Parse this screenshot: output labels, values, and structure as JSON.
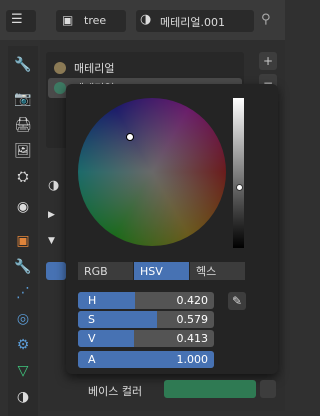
{
  "header": {
    "object_name": "tree",
    "material_name": "메테리얼.001"
  },
  "slots": [
    {
      "label": "매테리얼",
      "color": "#8b7a55"
    },
    {
      "label": "메테리얼.001",
      "color": "#3d7a63"
    }
  ],
  "side_buttons": {
    "add": "+",
    "remove": "−"
  },
  "colors": {
    "accent": "#4772b3",
    "base_color": "#2f7a53"
  },
  "picker": {
    "modes": [
      "RGB",
      "HSV",
      "헥스"
    ],
    "active_mode": "HSV",
    "hue": {
      "label": "H",
      "value": "0.420",
      "fill": 0.42
    },
    "sat": {
      "label": "S",
      "value": "0.579",
      "fill": 0.579
    },
    "val": {
      "label": "V",
      "value": "0.413",
      "fill": 0.413
    },
    "alpha": {
      "label": "A",
      "value": "1.000",
      "fill": 1.0
    }
  },
  "base_color_label": "베이스 컬러"
}
